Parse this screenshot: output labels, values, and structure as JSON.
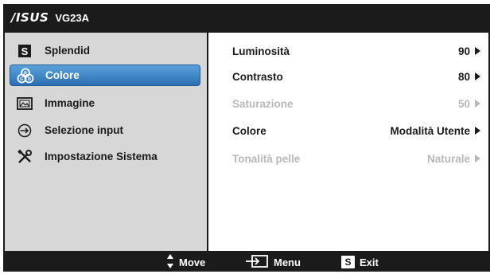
{
  "header": {
    "brand": "/ISUS",
    "model": "VG23A"
  },
  "menu": [
    {
      "label": "Splendid",
      "icon": "splendid-s-icon",
      "selected": false
    },
    {
      "label": "Colore",
      "icon": "color-circles-icon",
      "selected": true
    },
    {
      "label": "Immagine",
      "icon": "picture-icon",
      "selected": false
    },
    {
      "label": "Selezione input",
      "icon": "input-select-icon",
      "selected": false
    },
    {
      "label": "Impostazione Sistema",
      "icon": "tools-icon",
      "selected": false
    }
  ],
  "settings": [
    {
      "label": "Luminosità",
      "value": "90",
      "disabled": false
    },
    {
      "label": "Contrasto",
      "value": "80",
      "disabled": false
    },
    {
      "label": "Saturazione",
      "value": "50",
      "disabled": true
    },
    {
      "label": "Colore",
      "value": "Modalità Utente",
      "disabled": false
    },
    {
      "label": "Tonalità pelle",
      "value": "Naturale",
      "disabled": true
    }
  ],
  "footer": {
    "move_label": "Move",
    "menu_label": "Menu",
    "exit_key": "S",
    "exit_label": "Exit"
  },
  "colors": {
    "background": "#1b1b1b",
    "left_panel": "#d7d7d7",
    "selected": "#3f86c8",
    "disabled_text": "#b8b8b8"
  }
}
